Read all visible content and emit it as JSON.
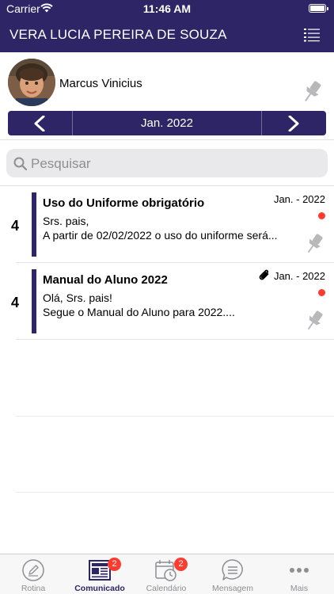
{
  "status_bar": {
    "carrier": "Carrier",
    "time": "11:46 AM"
  },
  "header": {
    "title": "VERA LUCIA PEREIRA DE SOUZA",
    "menu_icon": "list-icon"
  },
  "profile": {
    "name": "Marcus Vinicius",
    "pin_icon": "pin-icon"
  },
  "month_nav": {
    "label": "Jan. 2022",
    "prev_icon": "chevron-left-icon",
    "next_icon": "chevron-right-icon"
  },
  "search": {
    "placeholder": "Pesquisar"
  },
  "messages": [
    {
      "count": "4",
      "title": "Uso do Uniforme obrigatório",
      "date": "Jan. - 2022",
      "line1": "Srs. pais,",
      "line2": "A partir de 02/02/2022 o uso do uniforme será...",
      "has_attachment": false,
      "unread": true
    },
    {
      "count": "4",
      "title": "Manual do Aluno 2022",
      "date": "Jan. - 2022",
      "line1": "Olá, Srs. pais!",
      "line2": "Segue o Manual do Aluno para 2022....",
      "has_attachment": true,
      "unread": true
    }
  ],
  "tabs": [
    {
      "label": "Rotina",
      "icon": "pencil-icon"
    },
    {
      "label": "Comunicado",
      "icon": "newspaper-icon",
      "badge": "2",
      "active": true
    },
    {
      "label": "Calendário",
      "icon": "calendar-icon",
      "badge": "2"
    },
    {
      "label": "Mensagem",
      "icon": "message-icon"
    },
    {
      "label": "Mais",
      "icon": "more-icon"
    }
  ],
  "colors": {
    "brand": "#2e2566",
    "badge": "#ff3b30",
    "tab_inactive": "#8e8e93"
  }
}
